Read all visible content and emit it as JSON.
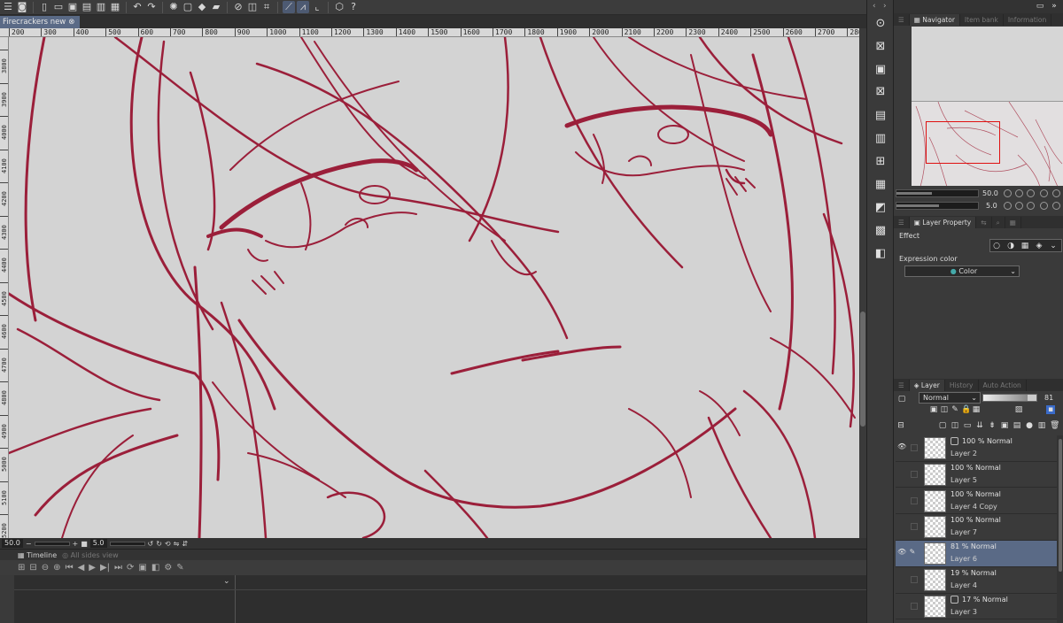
{
  "document": {
    "tab_title": "Firecrackers new"
  },
  "ruler": {
    "top_labels": [
      "200",
      "300",
      "400",
      "500",
      "600",
      "700",
      "800",
      "900",
      "1000",
      "1100",
      "1200",
      "1300",
      "1400",
      "1500",
      "1600",
      "1700",
      "1800",
      "1900",
      "2000",
      "2100",
      "2200",
      "2300",
      "2400",
      "2500",
      "2600",
      "2700",
      "280"
    ],
    "left_labels": [
      "3800",
      "3900",
      "4000",
      "4100",
      "4200",
      "4300",
      "4400",
      "4500",
      "4600",
      "4700",
      "4800",
      "4900",
      "5000",
      "5100",
      "5200"
    ]
  },
  "status": {
    "zoom": "50.0",
    "rotation": "5.0"
  },
  "timeline": {
    "tab_label": "Timeline",
    "tab2_label": "All sides view"
  },
  "panels": {
    "navigator_tabs": [
      "Navigator",
      "Item bank",
      "Information"
    ],
    "nav_zoom": "50.0",
    "nav_rotation": "5.0",
    "layer_property_tab": "Layer Property",
    "effect_label": "Effect",
    "expression_color_label": "Expression color",
    "expression_color_value": "Color",
    "layer_tabs": [
      "Layer",
      "History",
      "Auto Action"
    ],
    "blend_mode": "Normal",
    "opacity": "81",
    "layers": [
      {
        "mode": "100 % Normal",
        "name": "Layer 2",
        "visible": true,
        "has_icon": true,
        "selected": false
      },
      {
        "mode": "100 % Normal",
        "name": "Layer 5",
        "visible": false,
        "has_icon": false,
        "selected": false
      },
      {
        "mode": "100 % Normal",
        "name": "Layer 4 Copy",
        "visible": false,
        "has_icon": false,
        "selected": false
      },
      {
        "mode": "100 % Normal",
        "name": "Layer 7",
        "visible": false,
        "has_icon": false,
        "selected": false
      },
      {
        "mode": "81 % Normal",
        "name": "Layer 6",
        "visible": true,
        "has_icon": false,
        "selected": true
      },
      {
        "mode": "19 % Normal",
        "name": "Layer 4",
        "visible": false,
        "has_icon": false,
        "selected": false
      },
      {
        "mode": "17 % Normal",
        "name": "Layer 3",
        "visible": false,
        "has_icon": true,
        "selected": false
      }
    ]
  },
  "colors": {
    "stroke": "#9b1f3a",
    "canvas": "#d3d3d3",
    "selection": "#5a6a86",
    "navigator_frame": "#e01010"
  }
}
